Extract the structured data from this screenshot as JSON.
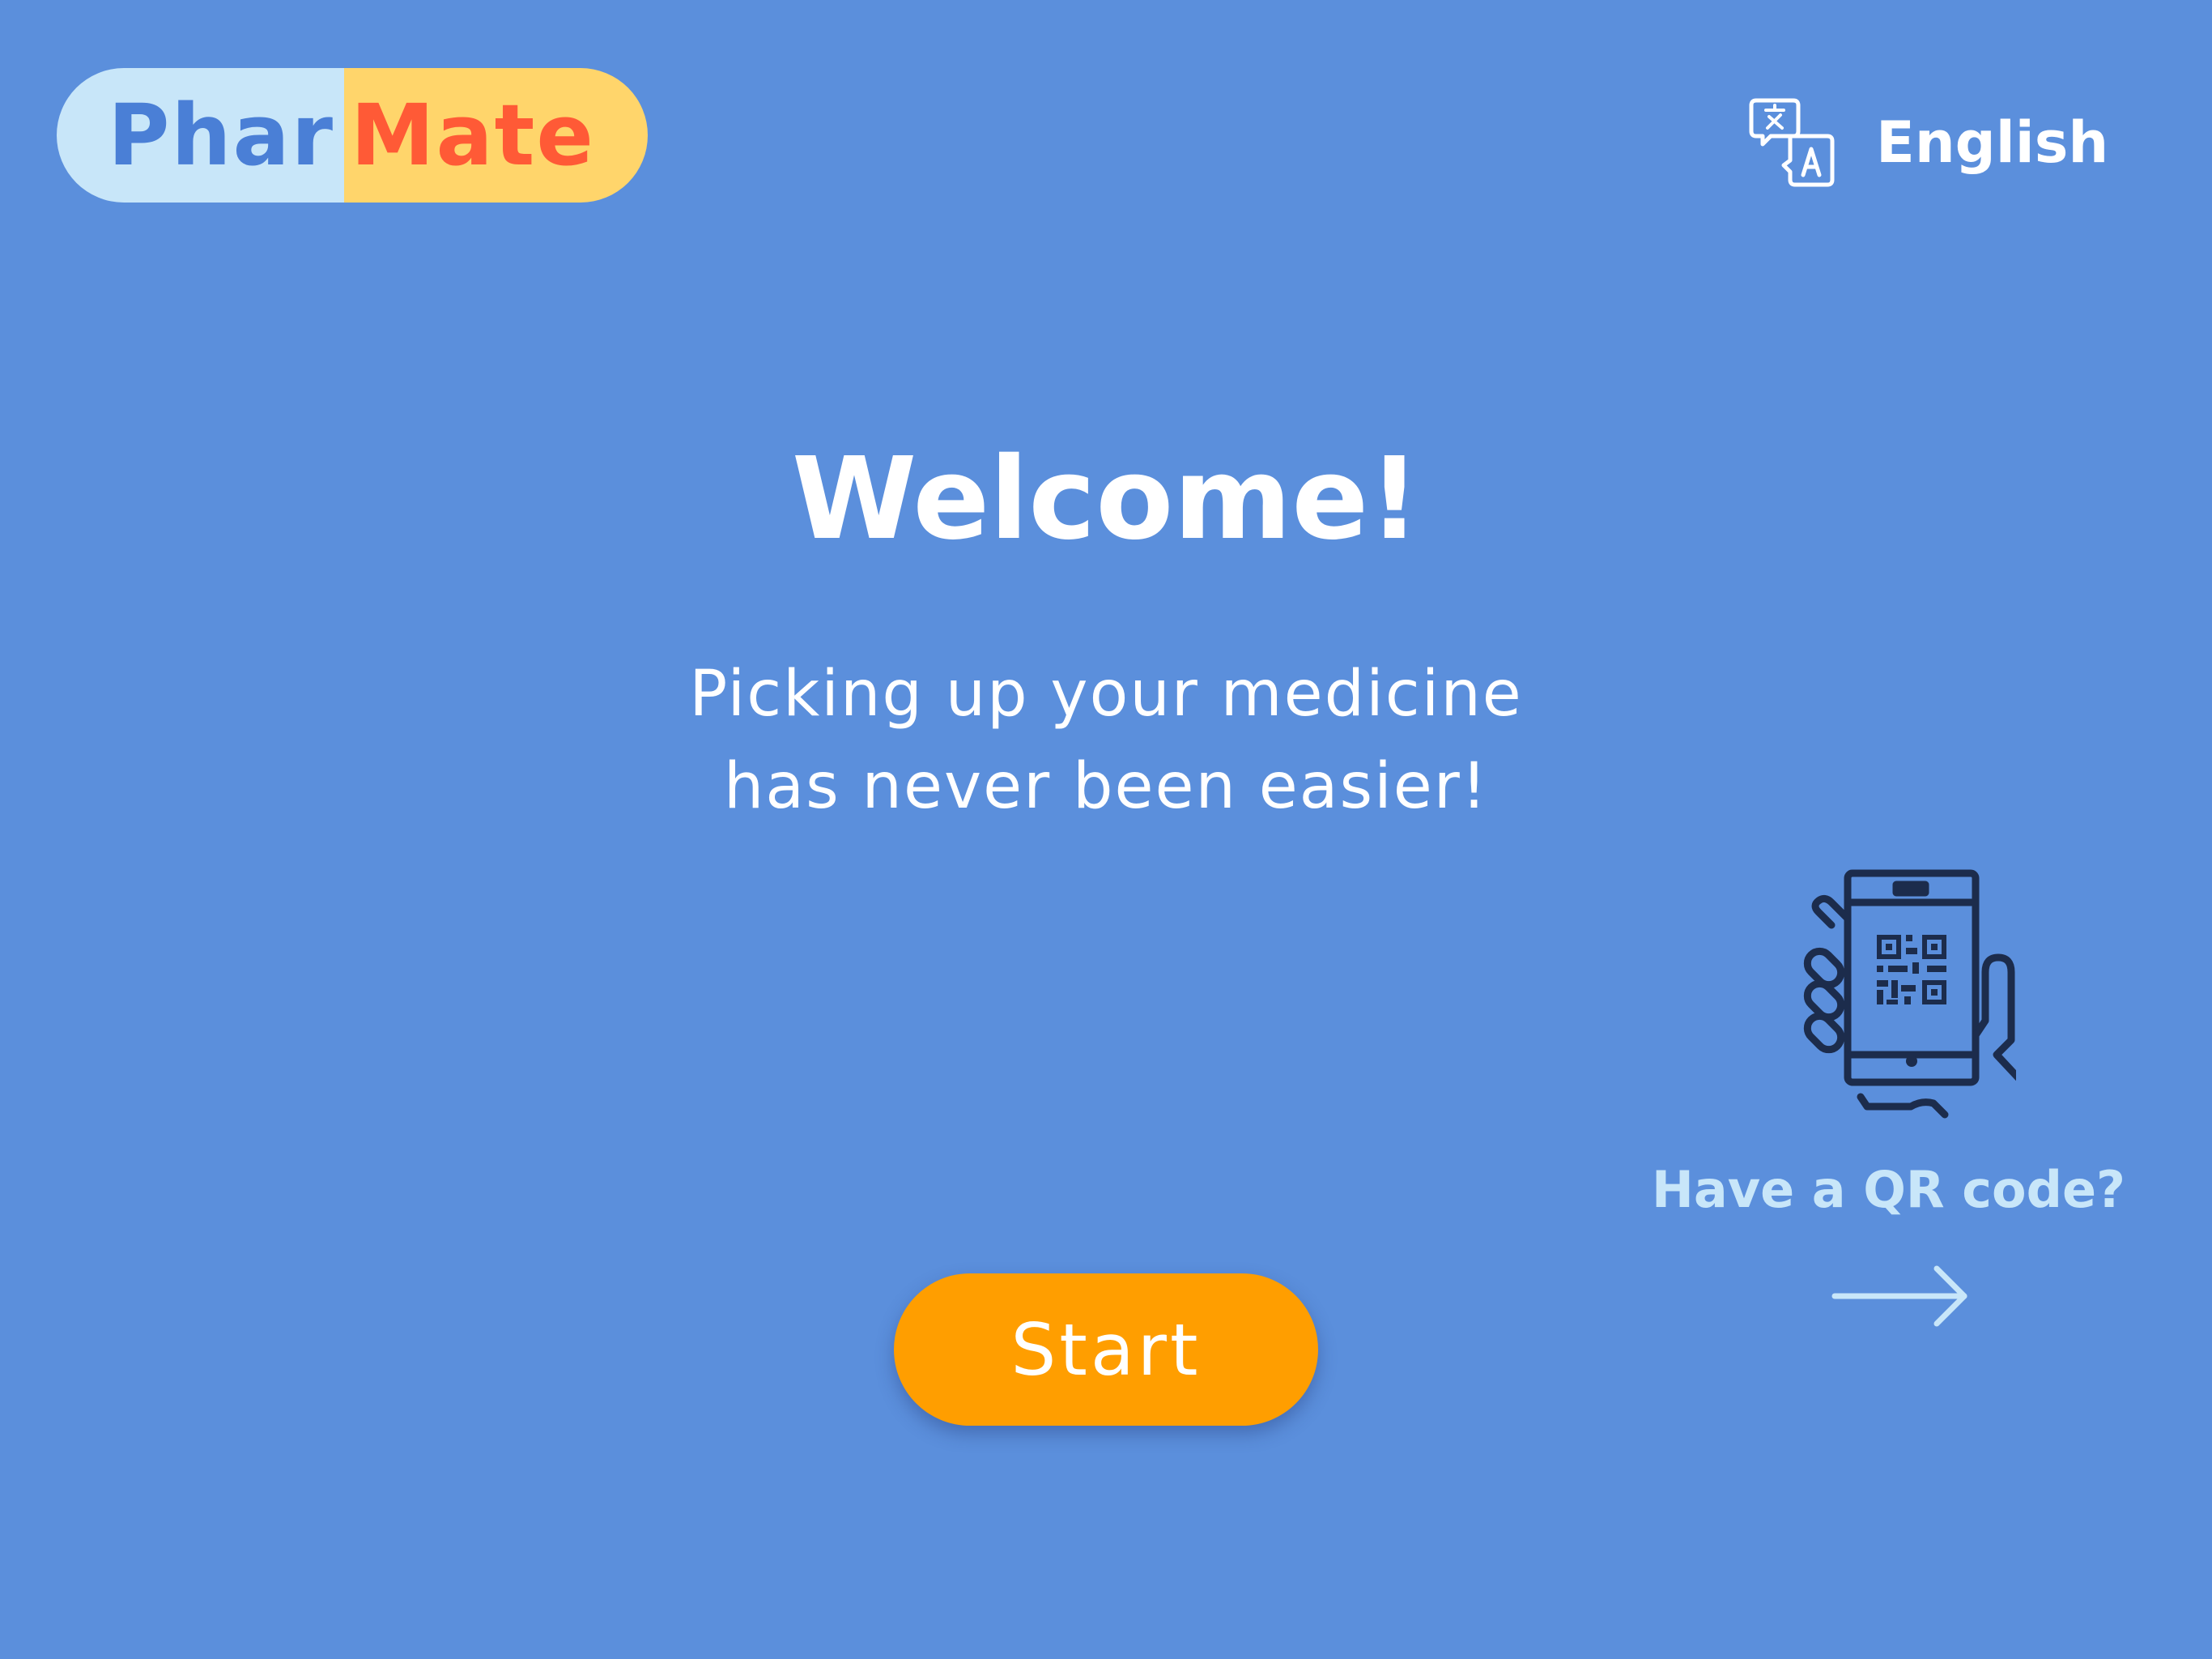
{
  "logo": {
    "part1": "Phar",
    "part2": "Mate"
  },
  "language": {
    "label": "English",
    "icon": "translate-icon"
  },
  "welcome": {
    "title": "Welcome!",
    "subtitle_line1": "Picking up your medicine",
    "subtitle_line2": "has never been easier!"
  },
  "start_button": {
    "label": "Start"
  },
  "qr": {
    "label": "Have a QR code?",
    "icon": "hand-phone-qr-icon",
    "arrow_icon": "arrow-right-icon"
  },
  "colors": {
    "background": "#5b8fdc",
    "start_button": "#ff9e00",
    "logo_left_bg": "#c8e6f9",
    "logo_right_bg": "#ffd56b",
    "logo_left_text": "#4a7fd6",
    "logo_right_text": "#ff5a36",
    "qr_text": "#c8e6f9",
    "icon_dark": "#1c2c4c"
  }
}
